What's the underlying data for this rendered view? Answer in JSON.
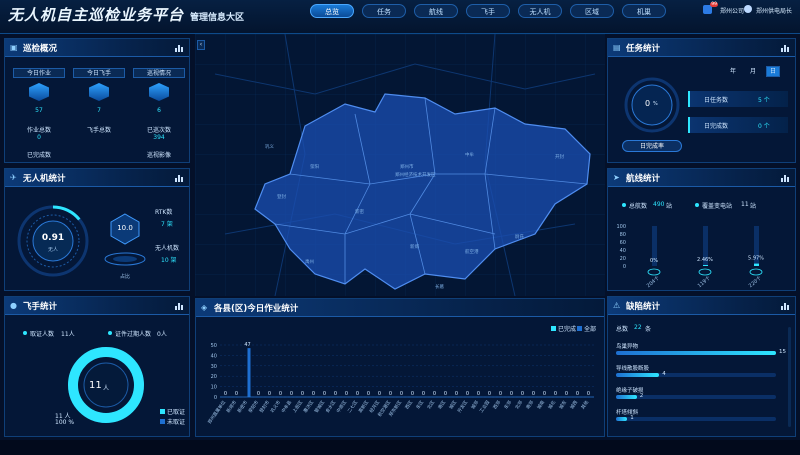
{
  "header": {
    "title": "无人机自主巡检业务平台",
    "subtitle": "管理信息大区",
    "tabs": [
      "总览",
      "任务",
      "航线",
      "飞手",
      "无人机",
      "区域",
      "机巢"
    ],
    "active_tab": 0,
    "user_org": "郑州公司",
    "user_badge": "99",
    "user_name": "郑州供电局长"
  },
  "colors": {
    "accent": "#1a7bd8",
    "cyan": "#2ee6ff",
    "bar_fill": "#1e6fd1",
    "bg": "#041029"
  },
  "inspection": {
    "title": "巡检概况",
    "cols": [
      {
        "btn": "今日作业",
        "val1": "57",
        "lbl1": "作业总数",
        "val2": "0",
        "lbl2": "已完成数"
      },
      {
        "btn": "今日飞手",
        "val1": "7",
        "lbl1": "飞手总数",
        "val2": "",
        "lbl2": ""
      },
      {
        "btn": "巡视情况",
        "val1": "6",
        "lbl1": "已巡次数",
        "val2": "394",
        "lbl2": "巡视影像"
      }
    ]
  },
  "task": {
    "title": "任务统计",
    "periods": [
      "年",
      "月",
      "日"
    ],
    "active_period": 2,
    "gauge_value": "0",
    "gauge_unit": "%",
    "gauge_label": "日完成率",
    "rows": [
      {
        "label": "日任务数",
        "value": "5",
        "unit": "个"
      },
      {
        "label": "日完成数",
        "value": "0",
        "unit": "个"
      }
    ]
  },
  "drone": {
    "title": "无人机统计",
    "gauge_value": "0.91",
    "gauge_sub": "%",
    "gauge_caption": "无人",
    "center_value": "10.0",
    "center_label": "占比",
    "side": [
      {
        "label": "RTK数",
        "value": "7",
        "unit": "架"
      },
      {
        "label": "无人机数",
        "value": "10",
        "unit": "架"
      }
    ]
  },
  "route": {
    "title": "航线统计",
    "total_label": "总航数",
    "total_value": "490",
    "total_unit": "站",
    "cover_label": "覆盖变电站",
    "cover_value": "11",
    "cover_unit": "站",
    "y_ticks": [
      "100",
      "80",
      "60",
      "40",
      "20",
      "0"
    ],
    "bars": [
      {
        "pct": "0%",
        "label": "204个",
        "fill": 0.0
      },
      {
        "pct": "2.46%",
        "label": "119个",
        "fill": 0.0246
      },
      {
        "pct": "5.97%",
        "label": "220个",
        "fill": 0.0597
      }
    ]
  },
  "pilot": {
    "title": "飞手统计",
    "legend1_label": "取证人数",
    "legend1_value": "11人",
    "legend2_label": "证件过期人数",
    "legend2_value": "0人",
    "center_value": "11",
    "center_unit": "人",
    "bottom_value": "11 人",
    "bottom_pct": "100 %",
    "legend_a": "已取证",
    "legend_b": "未取证",
    "ring_fraction": 1.0
  },
  "county": {
    "title": "各县(区)今日作业统计",
    "legend_a": "已完成",
    "legend_b": "全部",
    "y_ticks": [
      "50",
      "40",
      "30",
      "20",
      "10",
      "0"
    ],
    "chart_data": {
      "type": "bar",
      "title": "各县(区)今日作业统计",
      "ylim": [
        0,
        50
      ],
      "categories": [
        "郑州直属单位",
        "新郑市",
        "新密市",
        "荥阳市",
        "登封市",
        "巩义市",
        "中牟县",
        "上街区",
        "惠济区",
        "管城区",
        "金水区",
        "中原区",
        "二七区",
        "高新区",
        "经开区",
        "航空港区",
        "郑东新区",
        "西区",
        "东区",
        "北区",
        "南区",
        "城区",
        "开发区",
        "城郊",
        "工业园",
        "西郊",
        "东郊",
        "北郊",
        "南郊",
        "城南",
        "城北",
        "城东",
        "城西",
        "其他"
      ],
      "series": [
        {
          "name": "已完成",
          "values": [
            0,
            0,
            0,
            0,
            0,
            0,
            0,
            0,
            0,
            0,
            0,
            0,
            0,
            0,
            0,
            0,
            0,
            0,
            0,
            0,
            0,
            0,
            0,
            0,
            0,
            0,
            0,
            0,
            0,
            0,
            0,
            0,
            0,
            0
          ]
        },
        {
          "name": "全部",
          "values": [
            0,
            0,
            47,
            0,
            0,
            0,
            0,
            0,
            0,
            0,
            0,
            0,
            0,
            0,
            0,
            0,
            0,
            0,
            0,
            0,
            0,
            0,
            0,
            0,
            0,
            0,
            0,
            0,
            0,
            0,
            0,
            0,
            0,
            0
          ]
        }
      ],
      "value_labels": [
        "0",
        "0",
        "47",
        "0",
        "0",
        "0",
        "0",
        "0",
        "0",
        "0",
        "0",
        "0",
        "0",
        "0",
        "0",
        "0",
        "0",
        "0",
        "0",
        "0",
        "0",
        "0",
        "0",
        "0",
        "0",
        "0",
        "0",
        "0",
        "0",
        "0",
        "0",
        "0",
        "0",
        "0"
      ]
    }
  },
  "defect": {
    "title": "缺陷统计",
    "total_label": "总数",
    "total_value": "22",
    "total_unit": "条",
    "items": [
      {
        "label": "鸟巢异物",
        "value": "15",
        "fill": 1.0
      },
      {
        "label": "导线散股断股",
        "value": "4",
        "fill": 0.27
      },
      {
        "label": "绝缘子破损",
        "value": "2",
        "fill": 0.13
      },
      {
        "label": "杆塔倾斜",
        "value": "1",
        "fill": 0.07
      }
    ]
  },
  "map": {
    "labels": [
      {
        "t": "登封"
      },
      {
        "t": "巩义"
      },
      {
        "t": "新密"
      },
      {
        "t": "郑州市"
      },
      {
        "t": "荥阳"
      },
      {
        "t": "中牟"
      },
      {
        "t": "新郑"
      },
      {
        "t": "郑州经济技术开发区"
      },
      {
        "t": "航空港"
      },
      {
        "t": "尉氏"
      },
      {
        "t": "开封"
      },
      {
        "t": "禹州"
      },
      {
        "t": "长葛"
      }
    ]
  }
}
